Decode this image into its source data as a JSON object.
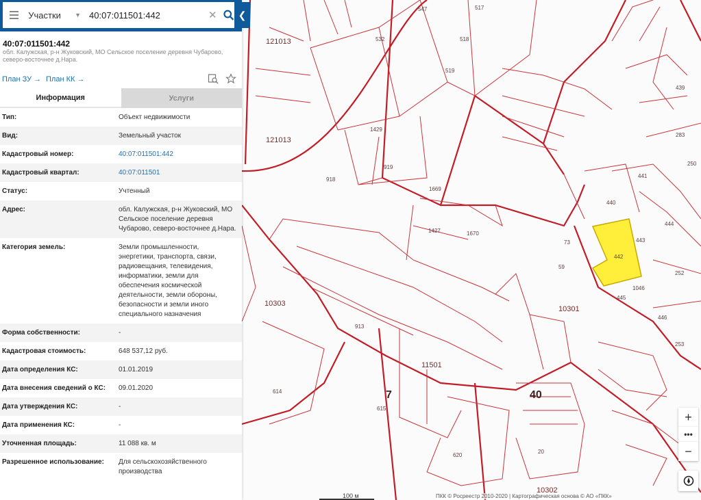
{
  "search": {
    "scope": "Участки",
    "query": "40:07:011501:442"
  },
  "object": {
    "title": "40:07:011501:442",
    "address": "обл. Калужская, р-н Жуковский, МО Сельское поселение деревня Чубарово, северо-восточнее д.Нара."
  },
  "links": {
    "plan_zu": "План ЗУ →",
    "plan_kk": "План КК →"
  },
  "tabs": {
    "info": "Информация",
    "services": "Услуги"
  },
  "rows": [
    {
      "key": "Тип:",
      "value": "Объект недвижимости"
    },
    {
      "key": "Вид:",
      "value": "Земельный участок"
    },
    {
      "key": "Кадастровый номер:",
      "value": "40:07:011501:442"
    },
    {
      "key": "Кадастровый квартал:",
      "value": "40:07:011501"
    },
    {
      "key": "Статус:",
      "value": "Учтенный"
    },
    {
      "key": "Адрес:",
      "value": "обл. Калужская, р-н Жуковский, МО Сельское поселение деревня Чубарово, северо-восточнее д.Нара."
    },
    {
      "key": "Категория земель:",
      "value": "Земли промышленности, энергетики, транспорта, связи, радиовещания, телевидения, информатики, земли для обеспечения космической деятельности, земли обороны, безопасности и земли иного специального назначения"
    },
    {
      "key": "Форма собственности:",
      "value": "-"
    },
    {
      "key": "Кадастровая стоимость:",
      "value": "648 537,12 руб."
    },
    {
      "key": "Дата определения КС:",
      "value": "01.01.2019"
    },
    {
      "key": "Дата внесения сведений о КС:",
      "value": "09.01.2020"
    },
    {
      "key": "Дата утверждения КС:",
      "value": "-"
    },
    {
      "key": "Дата применения КС:",
      "value": "-"
    },
    {
      "key": "Уточненная площадь:",
      "value": "11 088 кв. м"
    },
    {
      "key": "Разрешенное использование:",
      "value": "Для сельскохозяйственного производства"
    }
  ],
  "map": {
    "highlight_color": "#ffef3a",
    "quarters": [
      "121013",
      "121013",
      "10303",
      "10301",
      "11501",
      "10302"
    ],
    "big_labels": [
      "7",
      "40"
    ],
    "parcel_labels": [
      "547",
      "517",
      "532",
      "519",
      "518",
      "918",
      "919",
      "913",
      "1669",
      "1670",
      "1427",
      "614",
      "615",
      "620",
      "442",
      "441",
      "443",
      "444",
      "439",
      "283",
      "250",
      "252",
      "446",
      "253",
      "59",
      "73",
      "20",
      "1429",
      "440",
      "445",
      "1046"
    ]
  },
  "scale": {
    "label": "100 м"
  },
  "attribution": "ПКК © Росреестр 2010-2020 | Картографическая основа © АО «ПКК»",
  "icons": [
    "menu-icon",
    "chevron-down-icon",
    "clear-icon",
    "search-icon",
    "collapse-left-icon",
    "map-search-icon",
    "star-icon",
    "zoom-in-icon",
    "more-icon",
    "zoom-out-icon",
    "compass-icon"
  ]
}
